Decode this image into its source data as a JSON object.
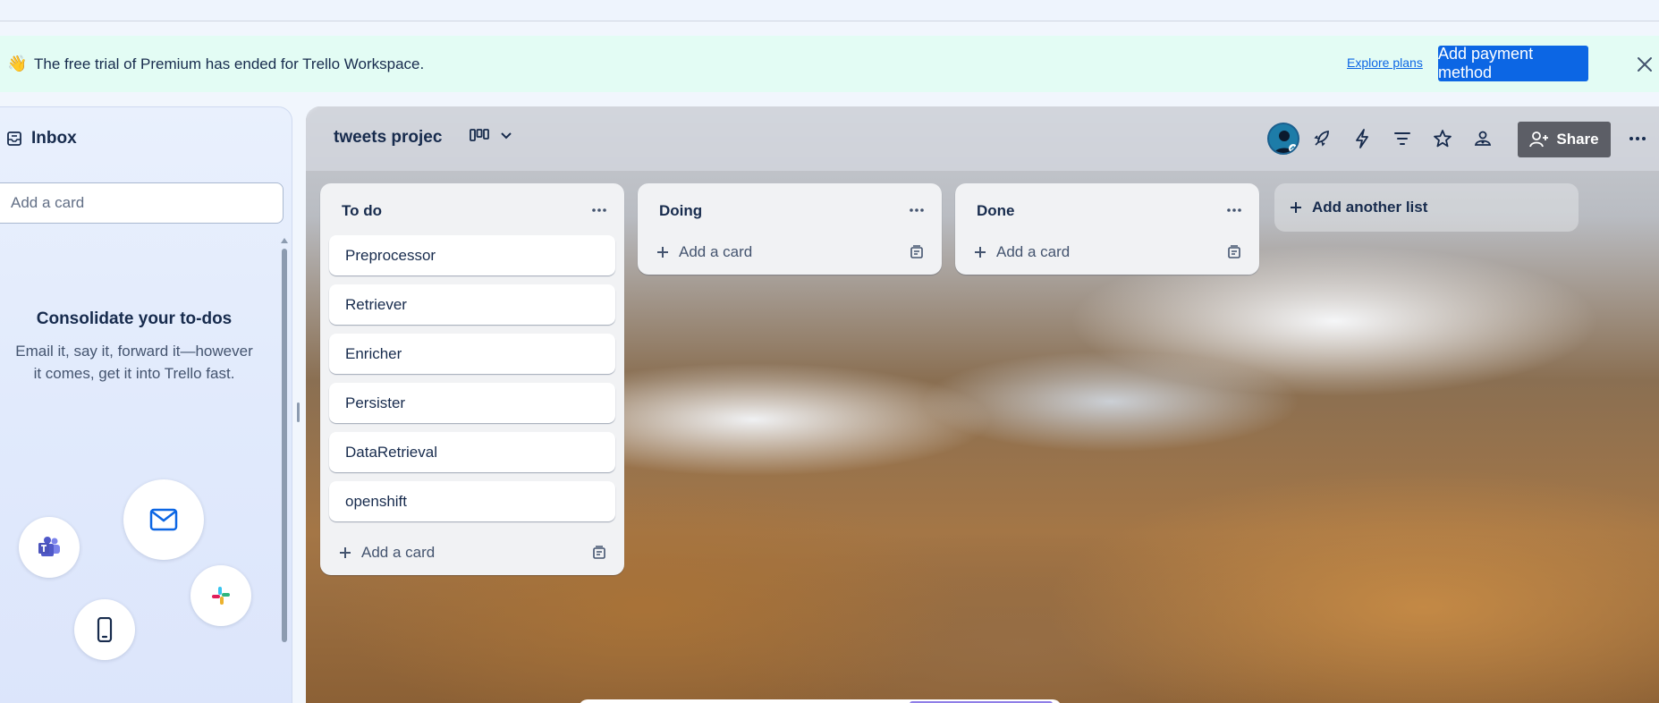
{
  "banner": {
    "icon": "waving-hand-emoji",
    "emoji": "👋",
    "message": "The free trial of Premium has ended for Trello Workspace.",
    "explore_label": "Explore plans",
    "pay_label": "Add payment method"
  },
  "inbox": {
    "title": "Inbox",
    "add_card_placeholder": "Add a card",
    "consolidate_title": "Consolidate your to-dos",
    "consolidate_desc": "Email it, say it, forward it—however it comes, get it into Trello fast.",
    "integrations": [
      "microsoft-teams-icon",
      "email-icon",
      "slack-icon",
      "mobile-phone-icon"
    ]
  },
  "board": {
    "title": "tweets projec",
    "share_label": "Share",
    "add_list_label": "Add another list",
    "lists": [
      {
        "name": "To do",
        "cards": [
          "Preprocessor",
          "Retriever",
          "Enricher",
          "Persister",
          "DataRetrieval",
          "openshift"
        ],
        "add_label": "Add a card"
      },
      {
        "name": "Doing",
        "cards": [],
        "add_label": "Add a card"
      },
      {
        "name": "Done",
        "cards": [],
        "add_label": "Add a card"
      }
    ]
  },
  "colors": {
    "primary": "#0c66e4",
    "banner_bg": "#e3fcf4",
    "share_bg": "#5c5e66",
    "list_bg": "#f1f2f4"
  }
}
